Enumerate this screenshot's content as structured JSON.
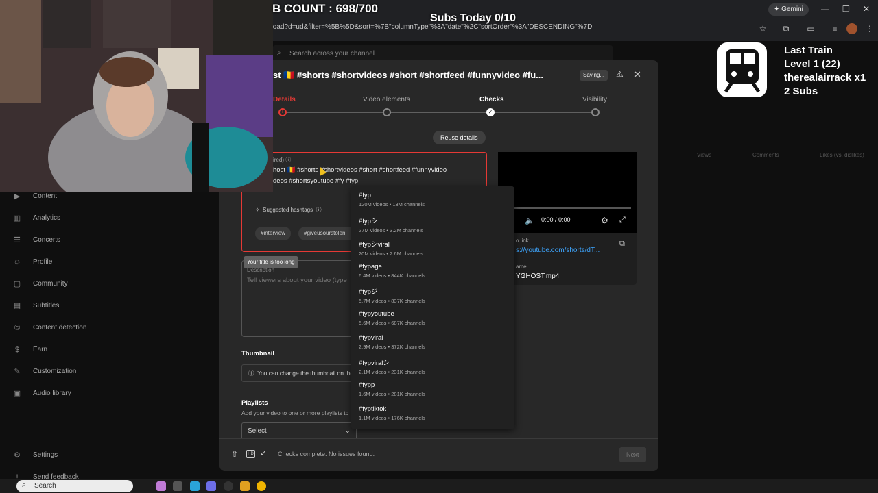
{
  "overlay": {
    "count_text": "B COUNT : 698/700",
    "subs_today": "Subs Today 0/10",
    "train": {
      "line1": "Last Train",
      "line2": "Level 1  (22)",
      "line3": "therealairrack x1",
      "line4": "2 Subs"
    }
  },
  "browser": {
    "url": "pload?d=ud&filter=%5B%5D&sort=%7B\"columnType\"%3A\"date\"%2C\"sortOrder\"%3A\"DESCENDING\"%7D",
    "gemini_label": "Gemini"
  },
  "studio": {
    "search_placeholder": "Search across your channel",
    "nav": [
      {
        "label": "Content",
        "icon": "content-icon"
      },
      {
        "label": "Analytics",
        "icon": "analytics-icon"
      },
      {
        "label": "Concerts",
        "icon": "concerts-icon"
      },
      {
        "label": "Profile",
        "icon": "profile-icon"
      },
      {
        "label": "Community",
        "icon": "community-icon"
      },
      {
        "label": "Subtitles",
        "icon": "subtitles-icon"
      },
      {
        "label": "Content detection",
        "icon": "copyright-icon"
      },
      {
        "label": "Earn",
        "icon": "dollar-icon"
      },
      {
        "label": "Customization",
        "icon": "customization-icon"
      },
      {
        "label": "Audio library",
        "icon": "audio-library-icon"
      },
      {
        "label": "Settings",
        "icon": "gear-icon"
      },
      {
        "label": "Send feedback",
        "icon": "feedback-icon"
      }
    ],
    "table_headers": [
      "Views",
      "Comments",
      "Likes (vs. dislikes)"
    ]
  },
  "dialog": {
    "title": "st 🇷🇴 #shorts #shortvideos #short #shortfeed #funnyvideo #fu...",
    "saving_label": "Saving...",
    "steps": [
      {
        "label": "Details",
        "state": "error"
      },
      {
        "label": "Video elements",
        "state": "todo"
      },
      {
        "label": "Checks",
        "state": "done"
      },
      {
        "label": "Visibility",
        "state": "todo"
      }
    ],
    "reuse_label": "Reuse details",
    "title_field": {
      "label": "ired)",
      "line1": "host 🇷🇴 #shorts #shortvideos #short #shortfeed #funnyvideo",
      "line2": "deos #shortsyoutube #fy #fyp"
    },
    "suggested_hashtags_label": "Suggested hashtags",
    "suggested_chips": [
      "#interview",
      "#giveusourstolen"
    ],
    "error_tooltip": "Your title is too long",
    "description": {
      "label": "Description",
      "placeholder": "Tell viewers about your video (type"
    },
    "thumbnail": {
      "label": "Thumbnail",
      "note": "You can change the thumbnail on the"
    },
    "playlists": {
      "label": "Playlists",
      "hint": "Add your video to one or more playlists to",
      "select": "Select"
    },
    "preview": {
      "time": "0:00 / 0:00",
      "link_label": "o link",
      "link": "s://youtube.com/shorts/dT...",
      "file_label": "ame",
      "file": "YGHOST.mp4"
    },
    "footer_status": "Checks complete. No issues found.",
    "next_label": "Next"
  },
  "hashtag_suggestions": [
    {
      "tag": "#fyp",
      "stats": "120M videos • 13M channels"
    },
    {
      "tag": "#fypシ",
      "stats": "27M videos • 3.2M channels"
    },
    {
      "tag": "#fypシviral",
      "stats": "20M videos • 2.6M channels"
    },
    {
      "tag": "#fypage",
      "stats": "6.4M videos • 844K channels"
    },
    {
      "tag": "#fypジ",
      "stats": "5.7M videos • 837K channels"
    },
    {
      "tag": "#fypyoutube",
      "stats": "5.6M videos • 687K channels"
    },
    {
      "tag": "#fypviral",
      "stats": "2.9M videos • 372K channels"
    },
    {
      "tag": "#fypviralシ",
      "stats": "2.1M videos • 231K channels"
    },
    {
      "tag": "#fypp",
      "stats": "1.6M videos • 281K channels"
    },
    {
      "tag": "#fyptiktok",
      "stats": "1.1M videos • 176K channels"
    }
  ],
  "taskbar": {
    "search_label": "Search"
  }
}
